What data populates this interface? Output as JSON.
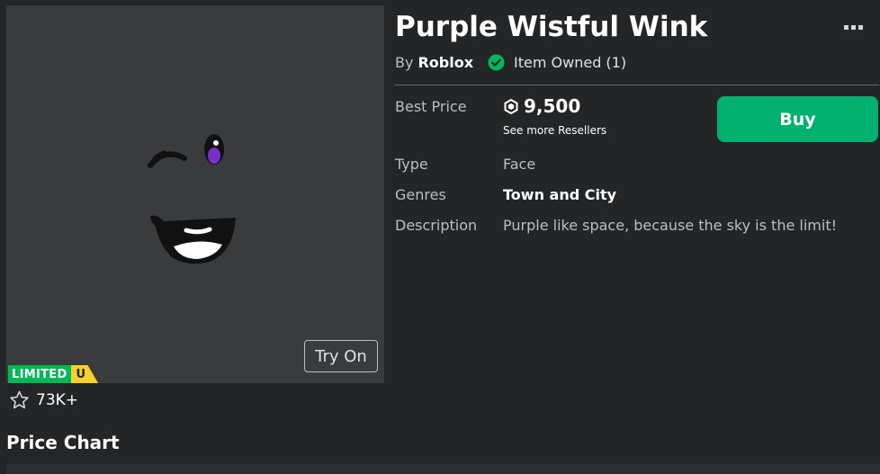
{
  "item": {
    "title": "Purple Wistful Wink",
    "by_label": "By",
    "creator": "Roblox",
    "owned_text": "Item Owned (1)",
    "try_on_label": "Try On",
    "limited_label": "LIMITED",
    "limited_u": "U",
    "favorites": "73K+"
  },
  "details": {
    "best_price_label": "Best Price",
    "price": "9,500",
    "resellers_link": "See more Resellers",
    "buy_label": "Buy",
    "type_label": "Type",
    "type_value": "Face",
    "genres_label": "Genres",
    "genres_value": "Town and City",
    "description_label": "Description",
    "description_value": "Purple like space, because the sky is the limit!"
  },
  "price_chart": {
    "title": "Price Chart"
  },
  "colors": {
    "background": "#232527",
    "thumbnail_bg": "#393b3d",
    "buy_button": "#00b06f",
    "verified": "#02b757",
    "limited_green": "#02b757",
    "limited_yellow": "#f8d12f",
    "eye_purple": "#7b2fc9"
  },
  "icons": {
    "more": "ellipsis-icon",
    "verified": "verified-check-icon",
    "robux": "robux-icon",
    "favorite": "star-outline-icon"
  }
}
